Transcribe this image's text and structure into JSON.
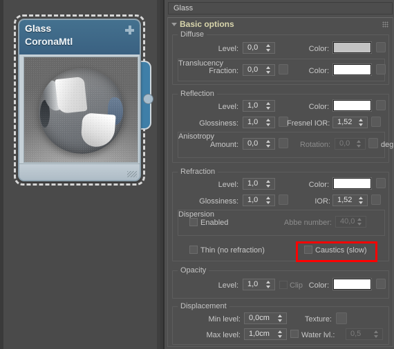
{
  "node_editor": {
    "node": {
      "name": "Glass",
      "type": "CoronaMtl",
      "add_icon": "plus-icon",
      "preview_alt": "material-sphere-preview",
      "selected": true
    }
  },
  "panel": {
    "title": "Glass",
    "grip_icon": "grip-dots-icon",
    "rollout": {
      "title": "Basic options",
      "collapse_icon": "chevron-down-icon",
      "expanded": true
    },
    "groups": {
      "diffuse": {
        "label": "Diffuse",
        "level_label": "Level:",
        "level_value": "0,0",
        "color_label": "Color:",
        "color_hex": "#c3c3c3",
        "translucency": {
          "label": "Translucency",
          "fraction_label": "Fraction:",
          "fraction_value": "0,0",
          "color_label": "Color:",
          "color_hex": "#ffffff"
        }
      },
      "reflection": {
        "label": "Reflection",
        "level_label": "Level:",
        "level_value": "1,0",
        "color_label": "Color:",
        "color_hex": "#ffffff",
        "glossiness_label": "Glossiness:",
        "glossiness_value": "1,0",
        "fresnel_label": "Fresnel IOR:",
        "fresnel_value": "1,52",
        "anisotropy": {
          "label": "Anisotropy",
          "amount_label": "Amount:",
          "amount_value": "0,0",
          "rotation_label": "Rotation:",
          "rotation_value": "0,0",
          "rotation_disabled": true,
          "unit_label": "deg"
        }
      },
      "refraction": {
        "label": "Refraction",
        "level_label": "Level:",
        "level_value": "1,0",
        "color_label": "Color:",
        "color_hex": "#ffffff",
        "glossiness_label": "Glossiness:",
        "glossiness_value": "1,0",
        "ior_label": "IOR:",
        "ior_value": "1,52",
        "dispersion": {
          "label": "Dispersion",
          "enabled_label": "Enabled",
          "enabled_checked": false,
          "abbe_label": "Abbe number:",
          "abbe_value": "40,0",
          "abbe_disabled": true
        },
        "thin_label": "Thin (no refraction)",
        "thin_checked": false,
        "caustics_label": "Caustics (slow)",
        "caustics_checked": false,
        "caustics_highlight_color": "#ff0000"
      },
      "opacity": {
        "label": "Opacity",
        "level_label": "Level:",
        "level_value": "1,0",
        "clip_label": "Clip",
        "clip_checked": false,
        "clip_disabled": true,
        "color_label": "Color:",
        "color_hex": "#ffffff"
      },
      "displacement": {
        "label": "Displacement",
        "min_label": "Min level:",
        "min_value": "0,0cm",
        "max_label": "Max level:",
        "max_value": "1,0cm",
        "texture_label": "Texture:",
        "water_label": "Water lvl.:",
        "water_value": "0,5",
        "water_checked": false,
        "water_disabled": true
      }
    }
  }
}
